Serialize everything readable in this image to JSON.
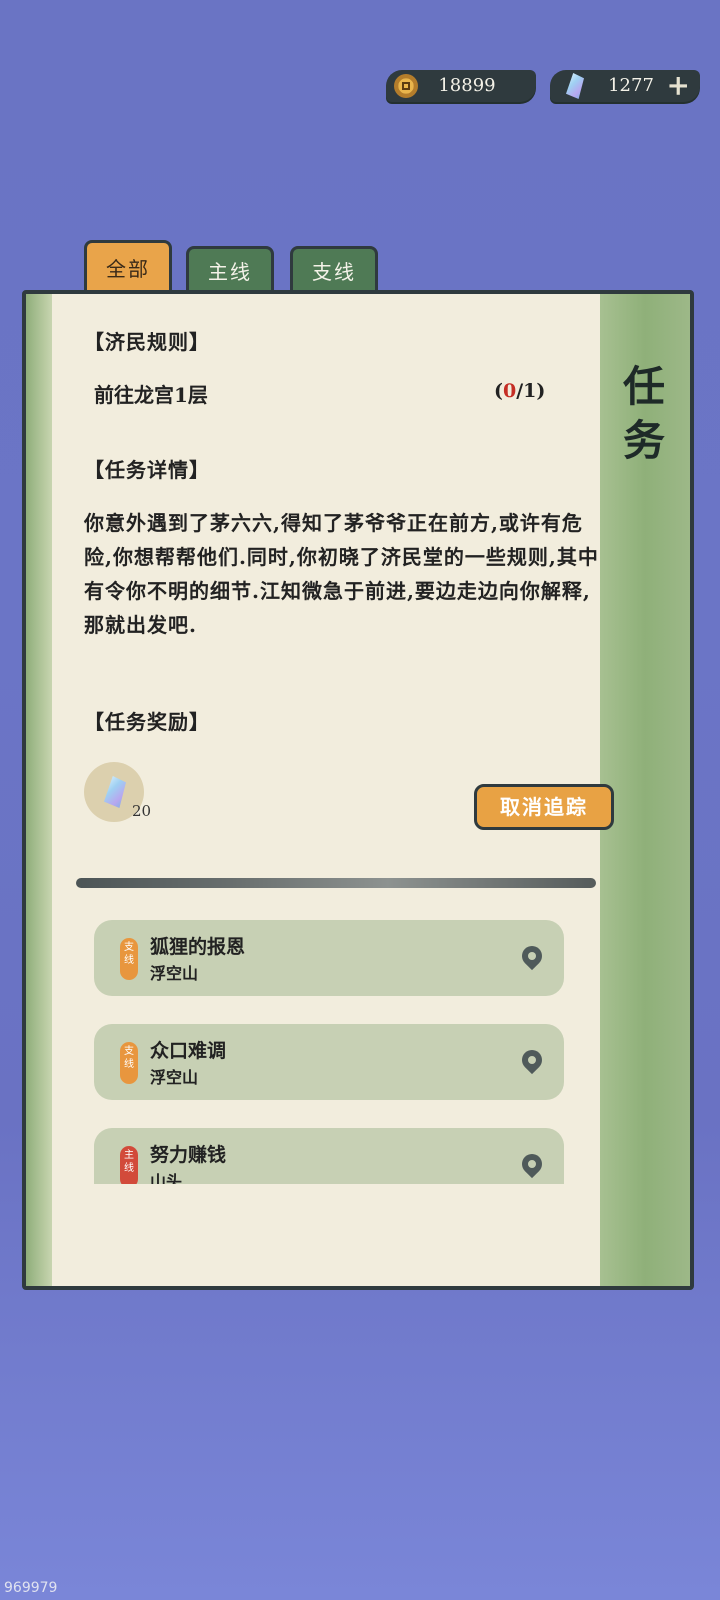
{
  "currencies": {
    "coins": "18899",
    "gems": "1277",
    "add": "+"
  },
  "tabs": [
    {
      "label": "全部"
    },
    {
      "label": "主线"
    },
    {
      "label": "支线"
    }
  ],
  "panel": {
    "title": "任务"
  },
  "quest": {
    "rule_head": "【济民规则】",
    "objective": "前往龙宫1层",
    "progress_done": "0",
    "progress_total": "/1",
    "detail_head": "【任务详情】",
    "description": "你意外遇到了茅六六,得知了茅爷爷正在前方,或许有危险,你想帮帮他们.同时,你初晓了济民堂的一些规则,其中有令你不明的细节.江知微急于前进,要边走边向你解释,那就出发吧.",
    "reward_head": "【任务奖励】",
    "reward_count": "20",
    "untrack_label": "取消追踪"
  },
  "quest_list": [
    {
      "badge": "支线",
      "title": "狐狸的报恩",
      "location": "浮空山"
    },
    {
      "badge": "支线",
      "title": "众口难调",
      "location": "浮空山"
    },
    {
      "badge": "主线",
      "title": "努力赚钱",
      "location": "山头"
    }
  ],
  "watermark": "969979"
}
